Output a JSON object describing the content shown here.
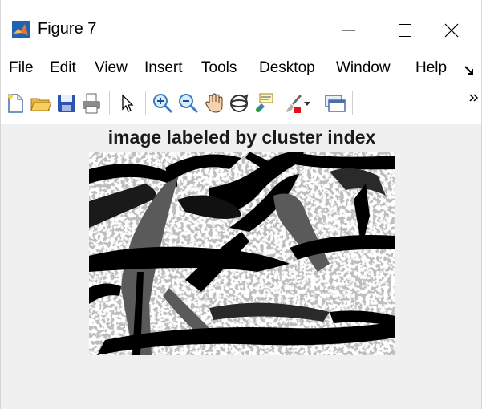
{
  "window": {
    "title": "Figure 7",
    "controls": [
      "minimize",
      "maximize",
      "close"
    ]
  },
  "menu": {
    "items": [
      "File",
      "Edit",
      "View",
      "Insert",
      "Tools",
      "Desktop",
      "Window",
      "Help"
    ]
  },
  "toolbar": {
    "icons": [
      "new-file-icon",
      "open-folder-icon",
      "save-icon",
      "print-icon",
      "pointer-icon",
      "zoom-in-icon",
      "zoom-out-icon",
      "pan-hand-icon",
      "rotate-3d-icon",
      "data-cursor-icon",
      "brush-icon",
      "dropdown-arrow-icon",
      "link-plot-icon",
      "overflow-chevron-icon"
    ]
  },
  "figure": {
    "title": "image labeled by cluster index",
    "colors": {
      "background_class": "#bdbdbd",
      "speckle_class": "#ffffff",
      "object_dark": "#000000",
      "object_mid": "#5a5a5a"
    }
  }
}
